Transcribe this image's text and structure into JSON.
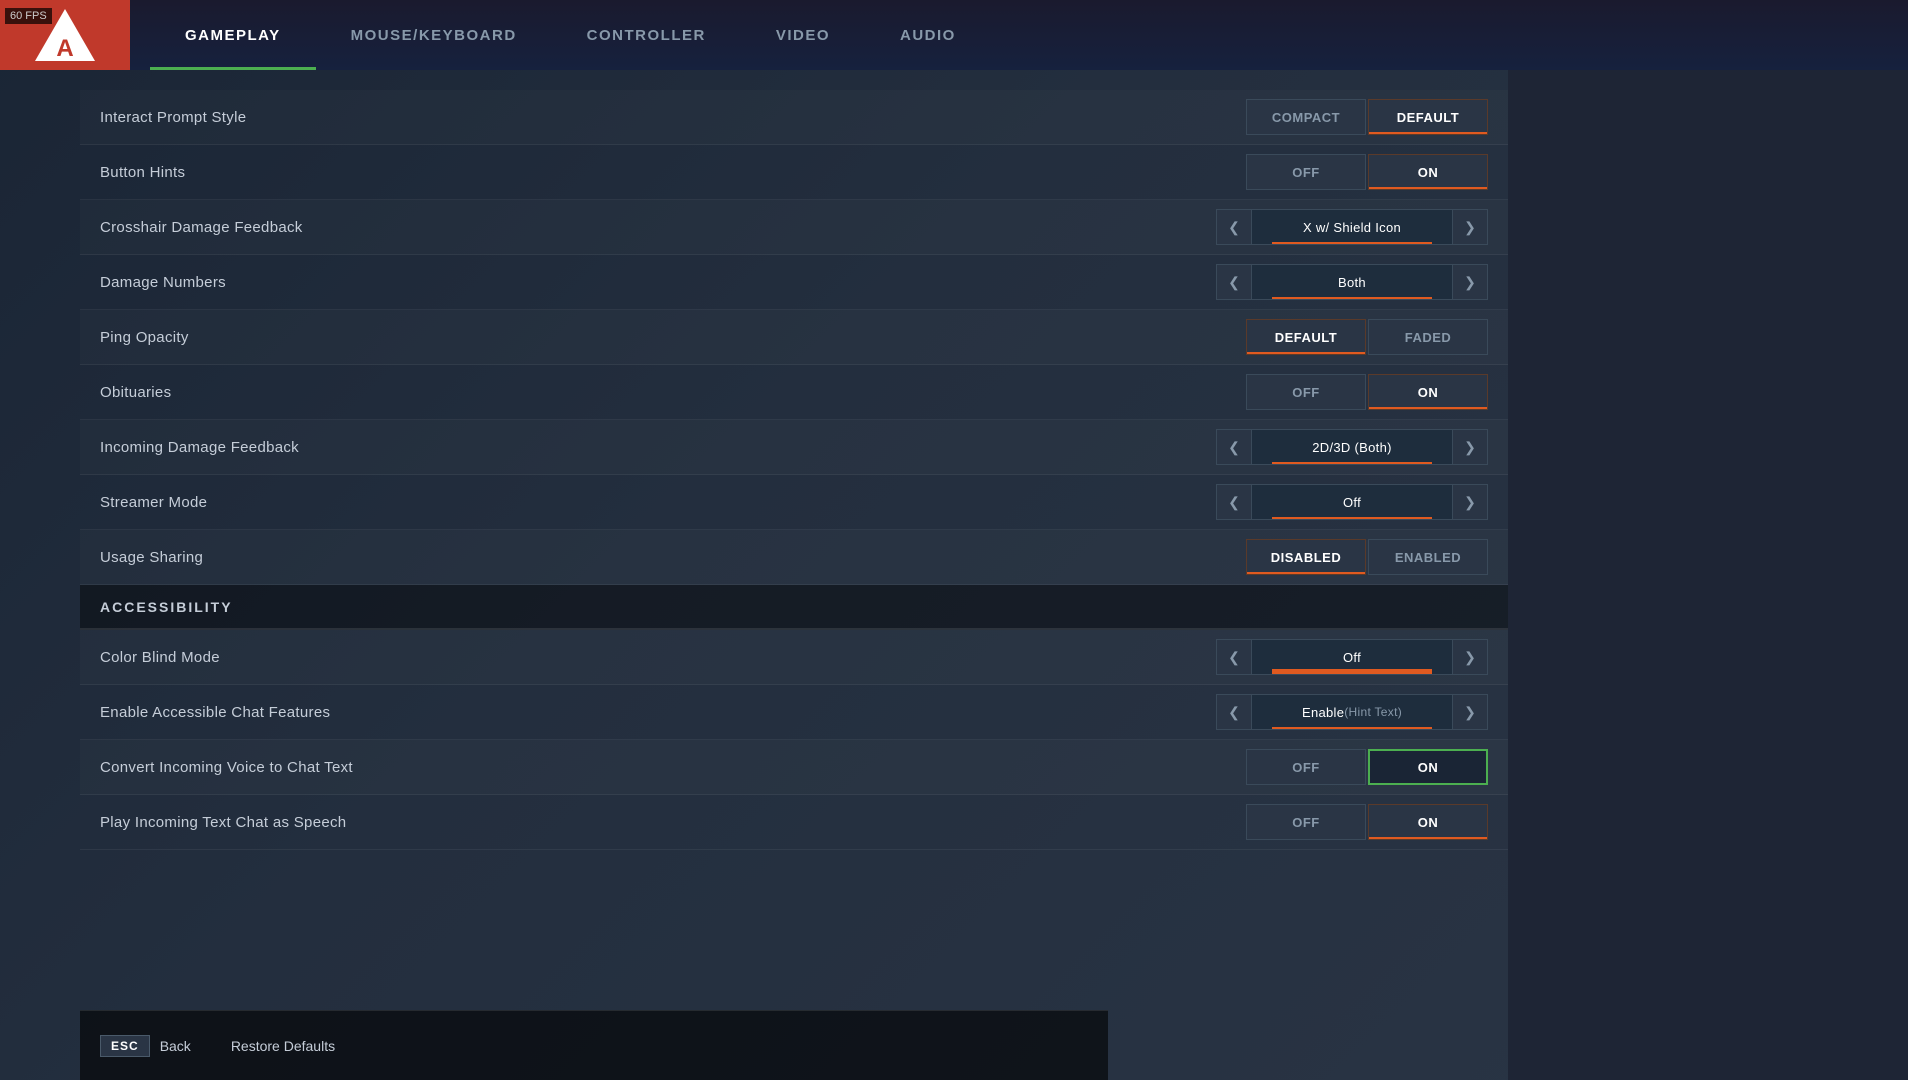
{
  "fps": "60 FPS",
  "nav": {
    "tabs": [
      {
        "id": "gameplay",
        "label": "GAMEPLAY",
        "active": true
      },
      {
        "id": "mouse-keyboard",
        "label": "MOUSE/KEYBOARD",
        "active": false
      },
      {
        "id": "controller",
        "label": "CONTROLLER",
        "active": false
      },
      {
        "id": "video",
        "label": "VIDEO",
        "active": false
      },
      {
        "id": "audio",
        "label": "AUDIO",
        "active": false
      }
    ]
  },
  "settings": [
    {
      "type": "row",
      "label": "Interact Prompt Style",
      "control": "toggle",
      "options": [
        {
          "label": "Compact",
          "active": false
        },
        {
          "label": "Default",
          "active": true
        }
      ]
    },
    {
      "type": "row",
      "label": "Button Hints",
      "control": "toggle",
      "options": [
        {
          "label": "Off",
          "active": false
        },
        {
          "label": "On",
          "active": true
        }
      ]
    },
    {
      "type": "row",
      "label": "Crosshair Damage Feedback",
      "control": "arrow",
      "value": "X w/ Shield Icon"
    },
    {
      "type": "row",
      "label": "Damage Numbers",
      "control": "arrow",
      "value": "Both"
    },
    {
      "type": "row",
      "label": "Ping Opacity",
      "control": "toggle",
      "options": [
        {
          "label": "Default",
          "active": true
        },
        {
          "label": "Faded",
          "active": false
        }
      ]
    },
    {
      "type": "row",
      "label": "Obituaries",
      "control": "toggle",
      "options": [
        {
          "label": "Off",
          "active": false
        },
        {
          "label": "On",
          "active": true
        }
      ]
    },
    {
      "type": "row",
      "label": "Incoming Damage Feedback",
      "control": "arrow",
      "value": "2D/3D (Both)"
    },
    {
      "type": "row",
      "label": "Streamer Mode",
      "control": "arrow",
      "value": "Off"
    },
    {
      "type": "row",
      "label": "Usage Sharing",
      "control": "toggle",
      "options": [
        {
          "label": "Disabled",
          "active": true
        },
        {
          "label": "Enabled",
          "active": false
        }
      ]
    },
    {
      "type": "section",
      "label": "ACCESSIBILITY"
    },
    {
      "type": "row",
      "label": "Color Blind Mode",
      "control": "arrow",
      "value": "Off",
      "color_indicator": "red"
    },
    {
      "type": "row",
      "label": "Enable Accessible Chat Features",
      "control": "arrow",
      "value": "Enable",
      "hint": "(Hint Text)"
    },
    {
      "type": "row",
      "label": "Convert Incoming Voice to Chat Text",
      "control": "toggle",
      "options": [
        {
          "label": "Off",
          "active": false
        },
        {
          "label": "On",
          "active": true,
          "special": "green"
        }
      ]
    },
    {
      "type": "row",
      "label": "Play Incoming Text Chat as Speech",
      "control": "toggle",
      "options": [
        {
          "label": "Off",
          "active": false
        },
        {
          "label": "On",
          "active": true
        }
      ]
    }
  ],
  "bottom": {
    "back_key": "ESC",
    "back_label": "Back",
    "restore_label": "Restore Defaults"
  }
}
